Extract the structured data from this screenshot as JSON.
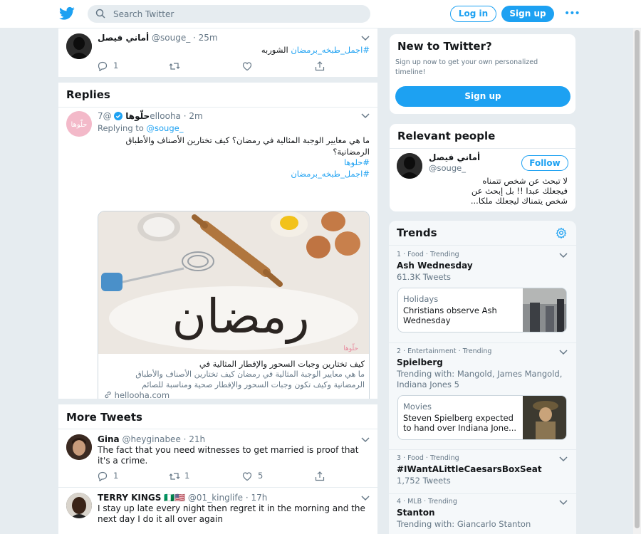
{
  "header": {
    "search_placeholder": "Search Twitter",
    "login_label": "Log in",
    "signup_label": "Sign up",
    "more_label": "•••",
    "accent": "#1da1f2"
  },
  "top_tweet": {
    "name": "أماني فيصل",
    "handle": "@souge_",
    "time": "· 25m",
    "hashtag": "#اجمل_طبخه_برمضان",
    "text": "الشوربه",
    "reply_count": "1"
  },
  "replies": {
    "title": "Replies",
    "tweet": {
      "name": "حلّوها",
      "handle": "@7ellooha",
      "time": "· 2m",
      "replying_prefix": "Replying to",
      "replying_handle": "@souge_",
      "line1": "ما هي معايير الوجبة المثالية في رمضان؟ كيف تختارين الأصناف والأطباق",
      "line2": "الرمضانية؟",
      "hashtag1": "#حلوها",
      "hashtag2": "#اجمل_طبخه_برمضان",
      "card_image_text": "رمضان",
      "card_watermark": "حلّوها",
      "card_title": "كيف تختارين وجبات السحور والإفطار المثالية في",
      "card_desc1": "ما هي معايير الوجبة المثالية في رمضان كيف تختارين الأصناف والأطباق",
      "card_desc2": "الرمضانية وكيف تكون وجبات السحور والإفطار صحية ومناسبة للصائم",
      "card_domain": "hellooha.com",
      "avatar_text": "حلّوها"
    }
  },
  "more_tweets": {
    "title": "More Tweets",
    "items": [
      {
        "name": "Gina",
        "handle": "@heyginabee",
        "time": "· 21h",
        "text": "The fact that you need witnesses to get married is proof that it's a crime.",
        "reply_count": "1",
        "retweet_count": "1",
        "like_count": "5"
      },
      {
        "name": "TERRY KINGS",
        "flags": "🇳🇬🇺🇸",
        "handle": "@01_kinglife",
        "time": "· 17h",
        "text": "I stay up late every night then regret it in the morning and the next day I do it all over again"
      }
    ]
  },
  "new_to_twitter": {
    "title": "New to Twitter?",
    "desc": "Sign up now to get your own personalized timeline!",
    "button": "Sign up"
  },
  "relevant_people": {
    "title": "Relevant people",
    "name": "أماني فيصل",
    "handle": "@souge_",
    "follow_label": "Follow",
    "bio1": "لا تبحث عن شخص تتمناه",
    "bio2": "فيجعلك عبدا !! بل إبحث عن",
    "bio3": "شخص يتمناك ليجعلك ملكا..."
  },
  "trends": {
    "title": "Trends",
    "items": [
      {
        "meta": "1 · Food · Trending",
        "name": "Ash Wednesday",
        "sub": "61.3K Tweets",
        "card_cat": "Holidays",
        "card_text": "Christians observe Ash Wednesday"
      },
      {
        "meta": "2 · Entertainment · Trending",
        "name": "Spielberg",
        "sub": "Trending with: Mangold, James Mangold, Indiana Jones 5",
        "card_cat": "Movies",
        "card_text": "Steven Spielberg expected to hand over Indiana Jone..."
      },
      {
        "meta": "3 · Food · Trending",
        "name": "#IWantALittleCaesarsBoxSeat",
        "sub": "1,752 Tweets"
      },
      {
        "meta": "4 · MLB · Trending",
        "name": "Stanton",
        "sub": "Trending with: Giancarlo Stanton"
      }
    ]
  }
}
